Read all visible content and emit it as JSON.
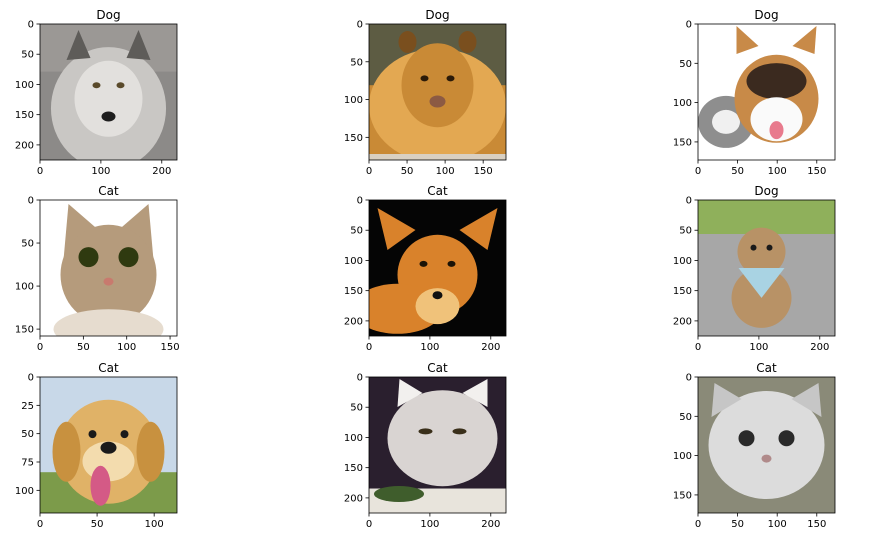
{
  "figure": {
    "background": "#ffffff"
  },
  "chart_data": [
    {
      "type": "image",
      "title": "Dog",
      "image": "grey wolf in snow",
      "extent": [
        225,
        225
      ],
      "xticks": [
        0,
        100,
        200
      ],
      "yticks": [
        0,
        50,
        100,
        150,
        200
      ],
      "colors": [
        "#8c8a88",
        "#c9c7c4",
        "#5e5c59",
        "#e2e0dd"
      ]
    },
    {
      "type": "image",
      "title": "Dog",
      "image": "lioness lying down",
      "extent": [
        180,
        180
      ],
      "xticks": [
        0,
        50,
        100,
        150
      ],
      "yticks": [
        0,
        50,
        100,
        150
      ],
      "colors": [
        "#c98a36",
        "#e3a852",
        "#7a4f1e",
        "#2b2219"
      ]
    },
    {
      "type": "image",
      "title": "Dog",
      "image": "corgi puppy with grey kitten",
      "extent": [
        173,
        173
      ],
      "xticks": [
        0,
        50,
        100,
        150
      ],
      "yticks": [
        0,
        50,
        100,
        150
      ],
      "colors": [
        "#ffffff",
        "#c88a48",
        "#3b2a1f",
        "#8e8e8e"
      ]
    },
    {
      "type": "image",
      "title": "Cat",
      "image": "tabby kitten with big eyes",
      "extent": [
        158,
        158
      ],
      "xticks": [
        0,
        50,
        100,
        150
      ],
      "yticks": [
        0,
        50,
        100,
        150
      ],
      "colors": [
        "#ffffff",
        "#b59b7c",
        "#7e6a52",
        "#e6dccf"
      ]
    },
    {
      "type": "image",
      "title": "Cat",
      "image": "red fox on black background",
      "extent": [
        225,
        225
      ],
      "xticks": [
        0,
        100,
        200
      ],
      "yticks": [
        0,
        50,
        100,
        150,
        200
      ],
      "colors": [
        "#050505",
        "#d9822b",
        "#f0c27a",
        "#ffffff"
      ]
    },
    {
      "type": "image",
      "title": "Dog",
      "image": "yorkshire terrier with blue bandana",
      "extent": [
        225,
        225
      ],
      "xticks": [
        0,
        100,
        200
      ],
      "yticks": [
        0,
        50,
        100,
        150,
        200
      ],
      "colors": [
        "#8fb05b",
        "#a7a7a7",
        "#b89266",
        "#a9d3e3"
      ]
    },
    {
      "type": "image",
      "title": "Cat",
      "image": "golden retriever puppy with tongue out",
      "extent": [
        120,
        120
      ],
      "xticks": [
        0,
        50,
        100
      ],
      "yticks": [
        0,
        25,
        50,
        75,
        100
      ],
      "colors": [
        "#c8d8e8",
        "#e0b267",
        "#f3dcae",
        "#d45a86"
      ]
    },
    {
      "type": "image",
      "title": "Cat",
      "image": "white cat at dinner table",
      "extent": [
        225,
        225
      ],
      "xticks": [
        0,
        100,
        200
      ],
      "yticks": [
        0,
        50,
        100,
        150,
        200
      ],
      "colors": [
        "#2a1f2e",
        "#d9d4d2",
        "#f2f0ee",
        "#3f5d2c"
      ]
    },
    {
      "type": "image",
      "title": "Cat",
      "image": "crying white cat",
      "extent": [
        173,
        173
      ],
      "xticks": [
        0,
        50,
        100,
        150
      ],
      "yticks": [
        0,
        50,
        100,
        150
      ],
      "colors": [
        "#8a8a78",
        "#dcdcdc",
        "#c6c6c6",
        "#2a2a2a"
      ]
    }
  ]
}
